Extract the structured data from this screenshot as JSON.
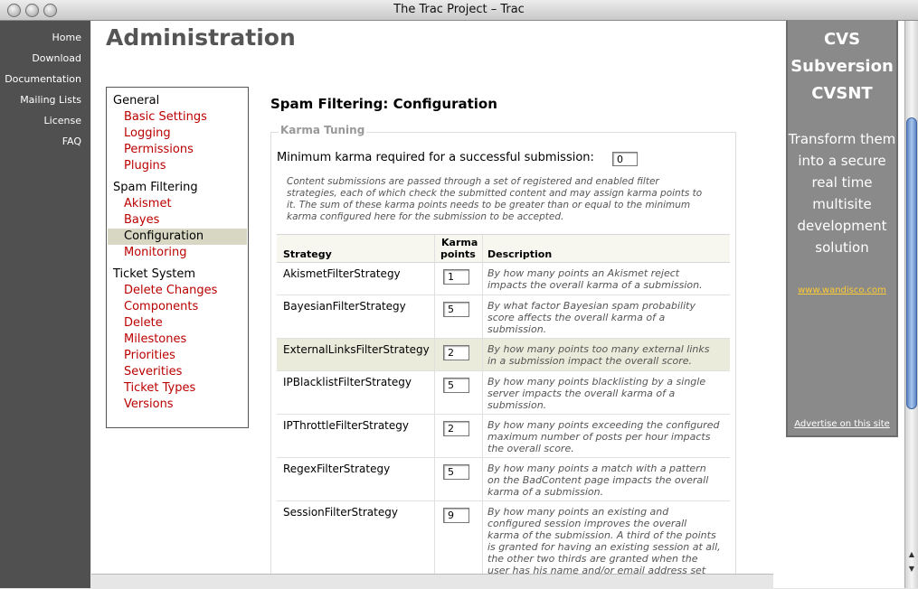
{
  "window": {
    "title": "The Trac Project – Trac"
  },
  "leftnav": {
    "items": [
      "Home",
      "Download",
      "Documentation",
      "Mailing Lists",
      "License",
      "FAQ"
    ]
  },
  "page": {
    "title": "Administration"
  },
  "adminnav": {
    "groups": [
      {
        "label": "General",
        "links": [
          "Basic Settings",
          "Logging",
          "Permissions",
          "Plugins"
        ]
      },
      {
        "label": "Spam Filtering",
        "links": [
          "Akismet",
          "Bayes",
          "Configuration",
          "Monitoring"
        ],
        "selected": "Configuration"
      },
      {
        "label": "Ticket System",
        "links": [
          "Delete Changes",
          "Components",
          "Delete",
          "Milestones",
          "Priorities",
          "Severities",
          "Ticket Types",
          "Versions"
        ]
      }
    ]
  },
  "panel": {
    "heading": "Spam Filtering: Configuration",
    "legend": "Karma Tuning",
    "min_karma_label": "Minimum karma required for a successful submission:",
    "min_karma_value": "0",
    "hint": "Content submissions are passed through a set of registered and enabled filter strategies, each of which check the submitted content and may assign karma points to it. The sum of these karma points needs to be greater than or equal to the minimum karma configured here for the submission to be accepted."
  },
  "table": {
    "headers": {
      "strategy": "Strategy",
      "karma_line1": "Karma",
      "karma_line2": "points",
      "description": "Description"
    },
    "rows": [
      {
        "strategy": "AkismetFilterStrategy",
        "karma": "1",
        "description": "By how many points an Akismet reject impacts the overall karma of a submission."
      },
      {
        "strategy": "BayesianFilterStrategy",
        "karma": "5",
        "description": "By what factor Bayesian spam probability score affects the overall karma of a submission."
      },
      {
        "strategy": "ExternalLinksFilterStrategy",
        "karma": "2",
        "description": "By how many points too many external links in a submission impact the overall score.",
        "highlighted": true
      },
      {
        "strategy": "IPBlacklistFilterStrategy",
        "karma": "5",
        "description": "By how many points blacklisting by a single server impacts the overall karma of a submission."
      },
      {
        "strategy": "IPThrottleFilterStrategy",
        "karma": "2",
        "description": "By how many points exceeding the configured maximum number of posts per hour impacts the overall score."
      },
      {
        "strategy": "RegexFilterStrategy",
        "karma": "5",
        "description": "By how many points a match with a pattern on the BadContent page impacts the overall karma of a submission."
      },
      {
        "strategy": "SessionFilterStrategy",
        "karma": "9",
        "description": "By how many points an existing and configured session improves the overall karma of the submission. A third of the points is granted for having an existing session at all, the other two thirds are granted when the user has his name and/or email address set"
      }
    ]
  },
  "ad": {
    "lines": [
      "CVS",
      "Subversion",
      "CVSNT"
    ],
    "text": [
      "Transform them",
      "into a secure",
      "real time",
      "multisite",
      "development",
      "solution"
    ],
    "url": "www.wandisco.com",
    "advertise": "Advertise on this site"
  },
  "colors": {
    "link": "#bb0000",
    "selected_bg": "#d7d7c4",
    "nav_bg": "#505050",
    "ad_bg": "#8a8a8a"
  }
}
